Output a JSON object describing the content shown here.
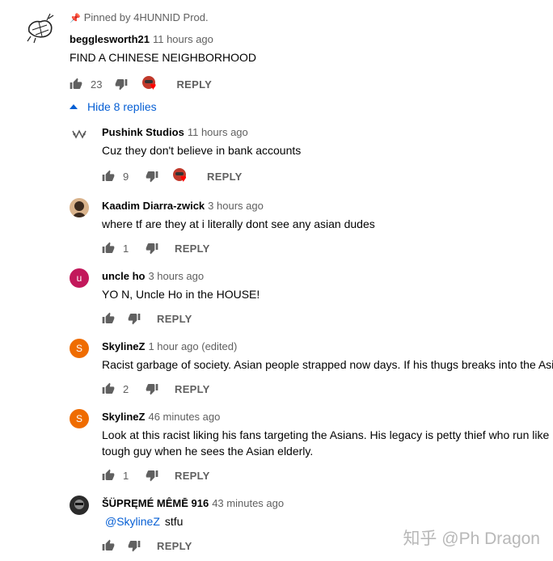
{
  "pinned": {
    "label": "Pinned by 4HUNNID Prod."
  },
  "main_comment": {
    "author": "begglesworth21",
    "time": "11 hours ago",
    "text": "FIND A CHINESE NEIGHBORHOOD",
    "likes": "23",
    "reply": "REPLY"
  },
  "hide_replies": "Hide 8 replies",
  "replies": [
    {
      "author": "Pushink Studios",
      "time": "11 hours ago",
      "text": "Cuz they don't believe in bank accounts",
      "likes": "9",
      "reply": "REPLY",
      "hearted": true
    },
    {
      "author": "Kaadim Diarra-zwick",
      "time": "3 hours ago",
      "text": "where tf are they at i literally dont see any asian dudes",
      "likes": "1",
      "reply": "REPLY"
    },
    {
      "author": "uncle ho",
      "time": "3 hours ago",
      "text": "YO N, Uncle Ho in the HOUSE!",
      "likes": "",
      "reply": "REPLY",
      "avatar_letter": "u",
      "avatar_color": "#c2185b"
    },
    {
      "author": "SkylineZ",
      "time": "1 hour ago (edited)",
      "text": "Racist garbage of society. Asian people strapped now days. If his thugs breaks into the Asi",
      "likes": "2",
      "reply": "REPLY",
      "avatar_letter": "S",
      "avatar_color": "#ef6c00"
    },
    {
      "author": "SkylineZ",
      "time": "46 minutes ago",
      "text_lines": [
        "Look at this racist liking his fans targeting the Asians. His legacy is petty thief who run like",
        "tough guy when he sees the Asian elderly."
      ],
      "likes": "1",
      "reply": "REPLY",
      "avatar_letter": "S",
      "avatar_color": "#ef6c00"
    },
    {
      "author": "ŠÜPRĘMÉ MÊMĒ 916",
      "time": "43 minutes ago",
      "mention": "@SkylineZ",
      "text": "stfu",
      "likes": "",
      "reply": "REPLY"
    }
  ],
  "watermark": "知乎 @Ph Dragon",
  "colors": {
    "link": "#065fd4",
    "secondary_text": "#606060",
    "heart": "#ff0000"
  }
}
